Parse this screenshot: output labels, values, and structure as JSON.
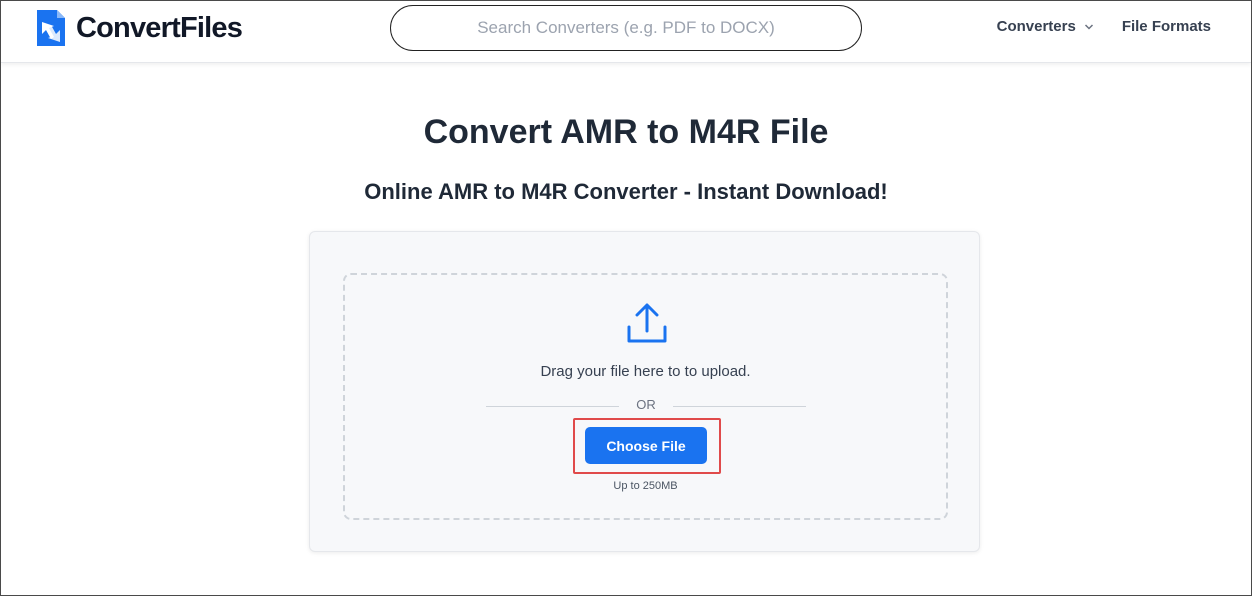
{
  "header": {
    "logo_text": "ConvertFiles",
    "search_placeholder": "Search Converters (e.g. PDF to DOCX)",
    "nav": {
      "converters_label": "Converters",
      "file_formats_label": "File Formats"
    }
  },
  "main": {
    "title": "Convert AMR to M4R File",
    "subtitle": "Online AMR to M4R Converter - Instant Download!",
    "upload": {
      "drag_text": "Drag your file here to to upload.",
      "or_text": "OR",
      "choose_button_label": "Choose File",
      "limit_text": "Up to 250MB"
    }
  },
  "icons": {
    "logo": "convertfiles-logo-icon",
    "upload": "upload-icon",
    "dropdown": "chevron-down-icon"
  },
  "colors": {
    "brand_blue": "#1a73f0",
    "highlight_red": "#e04a4a",
    "text_dark": "#1f2937"
  }
}
